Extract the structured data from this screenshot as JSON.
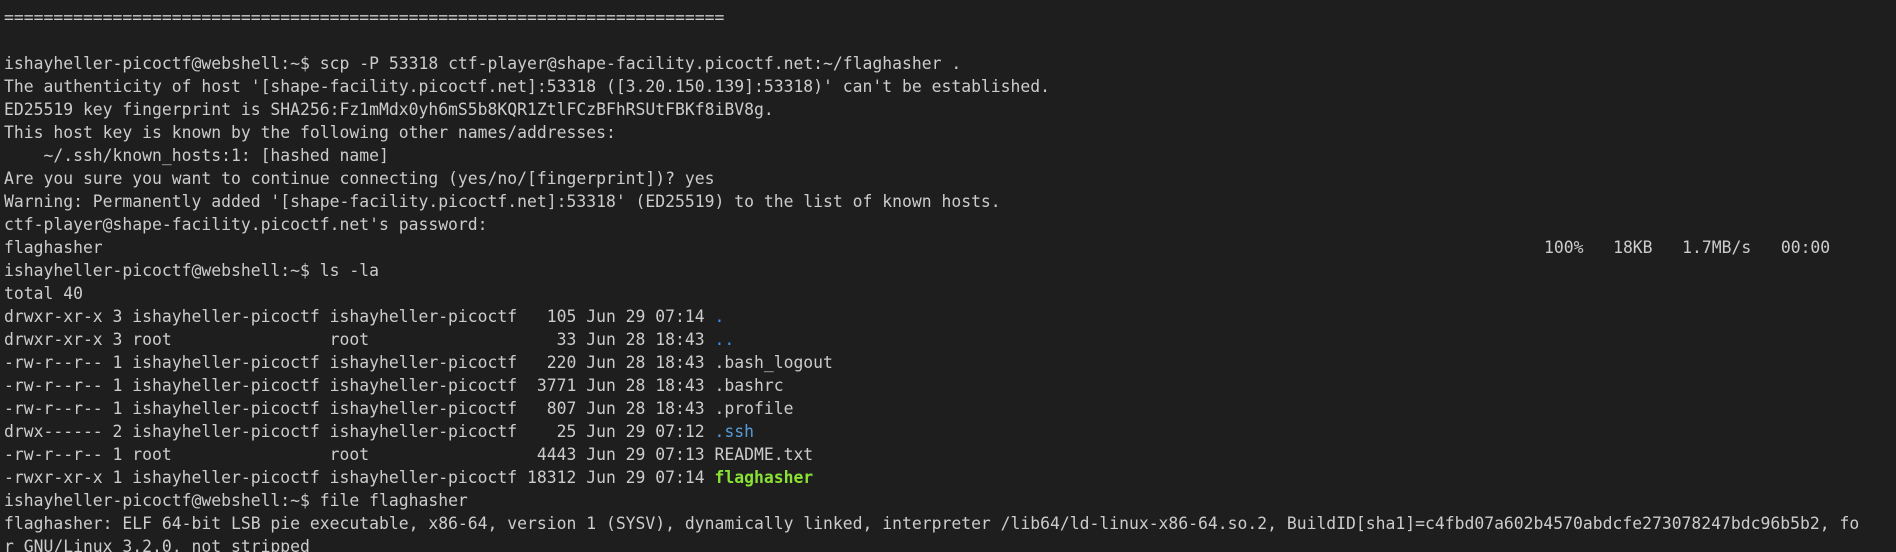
{
  "terminal": {
    "separator": "=========================================================================",
    "prompt": "ishayheller-picoctf@webshell:~$ ",
    "cmd_scp": "scp -P 53318 ctf-player@shape-facility.picoctf.net:~/flaghasher .",
    "scp_out": [
      "The authenticity of host '[shape-facility.picoctf.net]:53318 ([3.20.150.139]:53318)' can't be established.",
      "ED25519 key fingerprint is SHA256:Fz1mMdx0yh6mS5b8KQR1ZtlFCzBFhRSUtFBKf8iBV8g.",
      "This host key is known by the following other names/addresses:",
      "    ~/.ssh/known_hosts:1: [hashed name]",
      "Are you sure you want to continue connecting (yes/no/[fingerprint])? yes",
      "Warning: Permanently added '[shape-facility.picoctf.net]:53318' (ED25519) to the list of known hosts.",
      "ctf-player@shape-facility.picoctf.net's password:"
    ],
    "scp_file": "flaghasher",
    "scp_stats": "100%   18KB   1.7MB/s   00:00",
    "cmd_ls": "ls -la",
    "ls_total": "total 40",
    "ls_rows": [
      {
        "meta": "drwxr-xr-x 3 ishayheller-picoctf ishayheller-picoctf   105 Jun 29 07:14 ",
        "name": "."
      },
      {
        "meta": "drwxr-xr-x 3 root                root                   33 Jun 28 18:43 ",
        "name": ".."
      },
      {
        "meta": "-rw-r--r-- 1 ishayheller-picoctf ishayheller-picoctf   220 Jun 28 18:43 ",
        "name": ".bash_logout"
      },
      {
        "meta": "-rw-r--r-- 1 ishayheller-picoctf ishayheller-picoctf  3771 Jun 28 18:43 ",
        "name": ".bashrc"
      },
      {
        "meta": "-rw-r--r-- 1 ishayheller-picoctf ishayheller-picoctf   807 Jun 28 18:43 ",
        "name": ".profile"
      },
      {
        "meta": "drwx------ 2 ishayheller-picoctf ishayheller-picoctf    25 Jun 29 07:12 ",
        "name": ".ssh"
      },
      {
        "meta": "-rw-r--r-- 1 root                root                 4443 Jun 29 07:13 ",
        "name": "README.txt"
      },
      {
        "meta": "-rwxr-xr-x 1 ishayheller-picoctf ishayheller-picoctf 18312 Jun 29 07:14 ",
        "name": "flaghasher"
      }
    ],
    "cmd_file": "file flaghasher",
    "file_out_1": "flaghasher: ELF 64-bit LSB pie executable, x86-64, version 1 (SYSV), dynamically linked, interpreter /lib64/ld-linux-x86-64.so.2, BuildID[sha1]=c4fbd07a602b4570abdcfe273078247bdc96b5b2, fo",
    "file_out_2": "r GNU/Linux 3.2.0, not stripped",
    "colors": {
      "background": "#1e1e1e",
      "text": "#cccccc",
      "directory": "#3b8eea",
      "executable": "#8ae234"
    }
  }
}
